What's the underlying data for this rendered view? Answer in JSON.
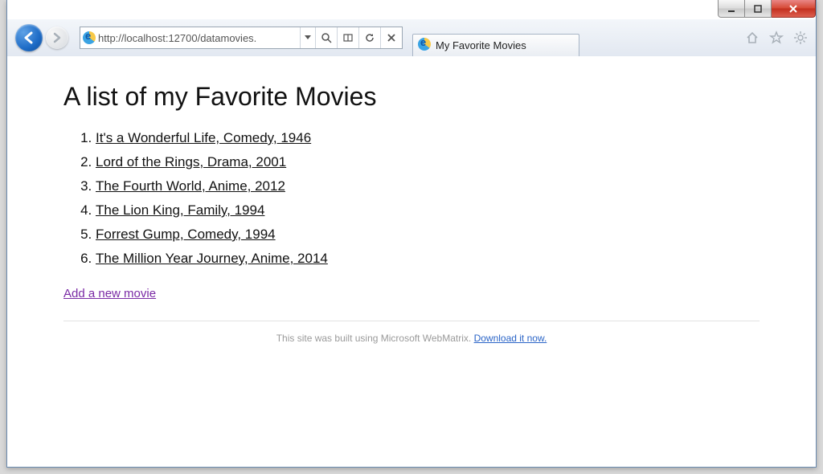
{
  "window": {
    "min_tooltip": "Minimize",
    "max_tooltip": "Maximize",
    "close_tooltip": "Close"
  },
  "browser": {
    "url_display": "http://localhost:12700/datamovies.",
    "tab_title": "My Favorite Movies"
  },
  "page": {
    "heading": "A list of my Favorite Movies",
    "movies": [
      "It's a Wonderful Life, Comedy, 1946",
      "Lord of the Rings, Drama, 2001",
      "The Fourth World, Anime, 2012",
      "The Lion King, Family, 1994",
      "Forrest Gump, Comedy, 1994",
      "The Million Year Journey, Anime, 2014"
    ],
    "add_link_label": "Add a new movie",
    "footer_text": "This site was built using Microsoft WebMatrix. ",
    "footer_link_label": "Download it now."
  }
}
